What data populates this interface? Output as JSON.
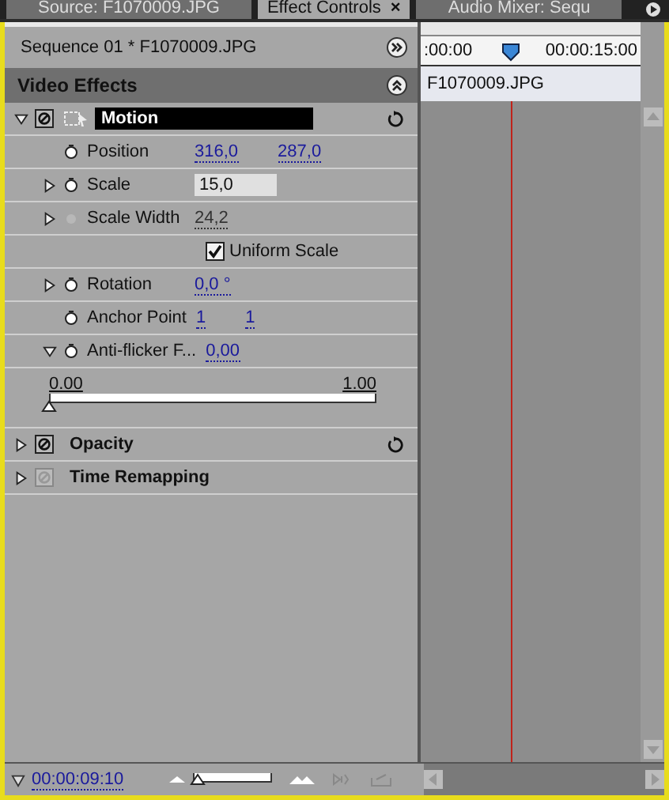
{
  "tabs": [
    {
      "label": "Source: F1070009.JPG",
      "selected": false
    },
    {
      "label": "Effect Controls",
      "selected": true,
      "close": "×"
    },
    {
      "label": "Audio Mixer: Sequ",
      "selected": false
    }
  ],
  "sequence_label": "Sequence 01 * F1070009.JPG",
  "section_title": "Video Effects",
  "ruler": {
    "start": ":00:00",
    "mark": "00:00:15:00"
  },
  "clip_label": "F1070009.JPG",
  "effects": [
    {
      "name": "Motion",
      "selected": true,
      "expanded": true,
      "fx_enabled": true,
      "reset": true,
      "properties": [
        {
          "kind": "value",
          "name": "Position",
          "stopwatch_enabled": true,
          "values": [
            "316,0",
            "287,0"
          ]
        },
        {
          "kind": "value",
          "name": "Scale",
          "stopwatch_enabled": true,
          "expanded": false,
          "editing": true,
          "values": [
            "15,0"
          ]
        },
        {
          "kind": "value",
          "name": "Scale Width",
          "stopwatch_enabled": false,
          "expanded": false,
          "values": [
            "24,2"
          ]
        },
        {
          "kind": "checkbox",
          "label": "Uniform Scale",
          "checked": true
        },
        {
          "kind": "value",
          "name": "Rotation",
          "stopwatch_enabled": true,
          "expanded": false,
          "values": [
            "0,0 °"
          ]
        },
        {
          "kind": "value",
          "name": "Anchor Point",
          "stopwatch_enabled": true,
          "values": [
            "1",
            "1"
          ]
        },
        {
          "kind": "value",
          "name": "Anti-flicker F...",
          "stopwatch_enabled": true,
          "expanded": true,
          "values": [
            "0,00"
          ]
        },
        {
          "kind": "slider",
          "min": "0.00",
          "max": "1.00",
          "level": 0
        }
      ]
    },
    {
      "name": "Opacity",
      "selected": false,
      "expanded": false,
      "fx_enabled": true,
      "reset": true
    },
    {
      "name": "Time Remapping",
      "selected": false,
      "expanded": false,
      "fx_enabled": false,
      "reset": false
    }
  ],
  "timecode": "00:00:09:10",
  "zoom": {
    "level": 0.05
  }
}
